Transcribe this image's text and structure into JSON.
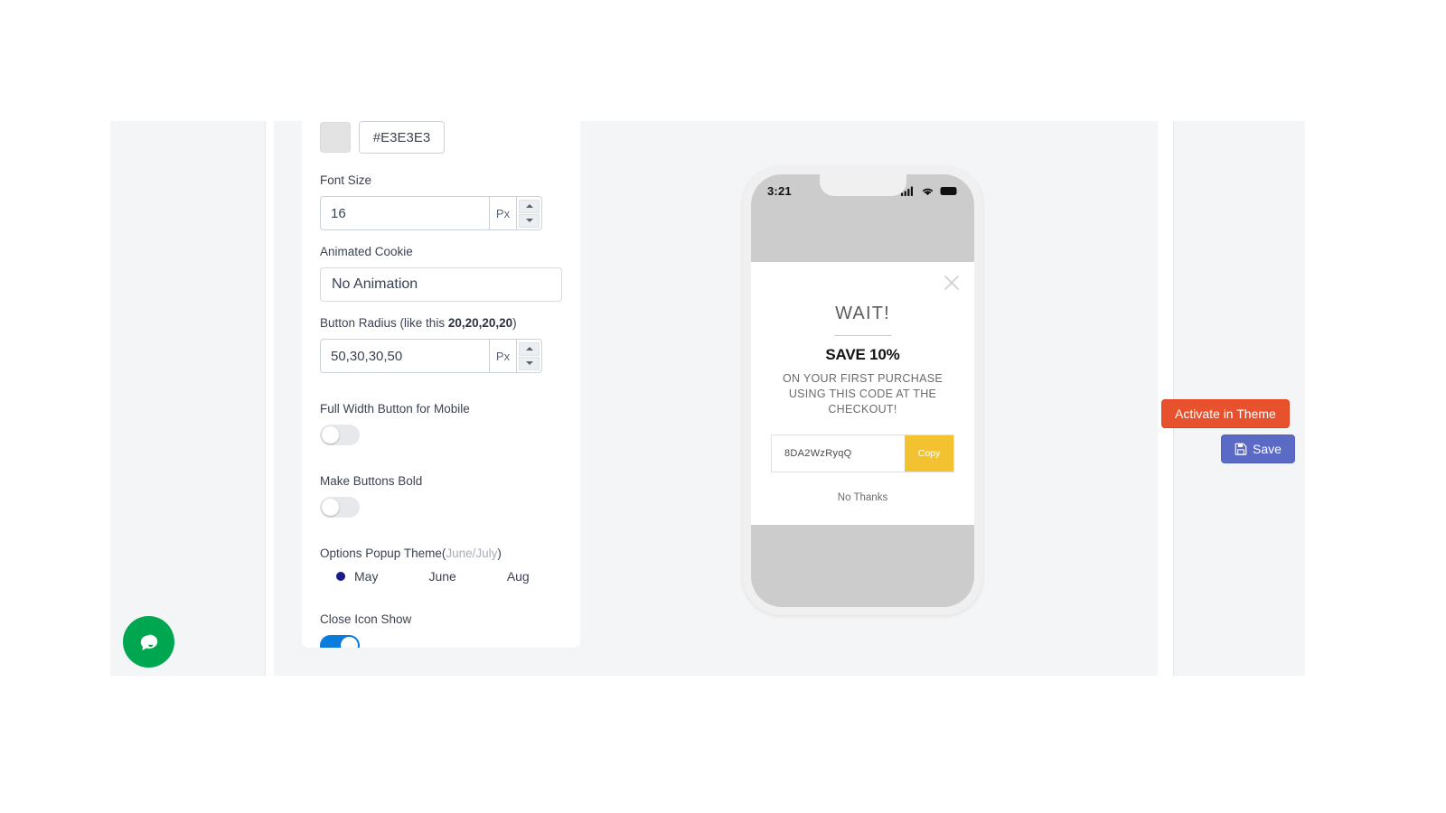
{
  "settings": {
    "color_field": {
      "swatch_color": "#E3E3E3",
      "hex_value": "#E3E3E3"
    },
    "font_size": {
      "label": "Font Size",
      "value": "16",
      "unit": "Px"
    },
    "animated_cookie": {
      "label": "Animated Cookie",
      "value": "No Animation"
    },
    "button_radius": {
      "label_prefix": "Button Radius (like this ",
      "label_bold": "20,20,20,20",
      "label_suffix": ")",
      "value": "50,30,30,50",
      "unit": "Px"
    },
    "full_width_button": {
      "label": "Full Width Button for Mobile",
      "state": "off"
    },
    "make_buttons_bold": {
      "label": "Make Buttons Bold",
      "state": "off"
    },
    "options_popup_theme": {
      "label_main": "Options Popup Theme(",
      "label_muted": "June/July",
      "label_end": ")",
      "options": [
        {
          "label": "May",
          "selected": true
        },
        {
          "label": "June",
          "selected": false
        },
        {
          "label": "Aug",
          "selected": false
        }
      ],
      "selected_color": "#1A1A8C"
    },
    "close_icon_show": {
      "label": "Close Icon Show",
      "state": "on",
      "on_color": "#0A7CDB"
    }
  },
  "preview": {
    "phone": {
      "status_time": "3:21",
      "status_icons": [
        "signal-icon",
        "wifi-icon",
        "battery-icon"
      ],
      "screen_color": "#CCCCCC"
    },
    "popup": {
      "close_icon": "close-icon",
      "heading": "WAIT!",
      "save_line": "SAVE 10%",
      "subtext": "ON YOUR FIRST PURCHASE USING THIS CODE AT THE CHECKOUT!",
      "coupon_code": "8DA2WzRyqQ",
      "copy_label": "Copy",
      "copy_button_color": "#F2C230",
      "decline_label": "No Thanks"
    }
  },
  "actions": {
    "activate_label": "Activate in Theme",
    "activate_color": "#E8512E",
    "save_label": "Save",
    "save_color": "#5B6AC4",
    "save_icon": "floppy-disk-icon"
  },
  "chat_widget": {
    "icon": "chat-bubble-icon",
    "color": "#00A650"
  }
}
